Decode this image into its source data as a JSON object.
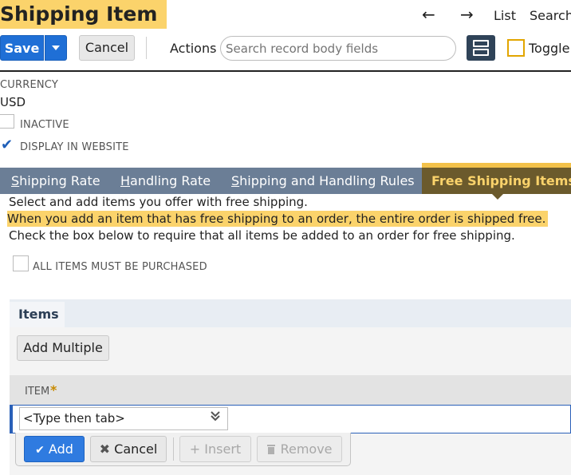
{
  "header": {
    "title": "Shipping Item",
    "nav_back_icon": "←",
    "nav_forward_icon": "→",
    "list_link": "List",
    "search_link": "Search"
  },
  "toolbar": {
    "save_label": "Save",
    "cancel_label": "Cancel",
    "actions_label": "Actions",
    "search_placeholder": "Search record body fields",
    "toggle_label": "Toggle"
  },
  "fields": {
    "currency_label": "CURRENCY",
    "currency_value": "USD",
    "inactive_label": "INACTIVE",
    "inactive_checked": false,
    "display_label": "DISPLAY IN WEBSITE",
    "display_checked": true,
    "check_glyph": "✔"
  },
  "tabs": [
    {
      "label": "Shipping Rate",
      "active": false
    },
    {
      "label": "Handling Rate",
      "active": false
    },
    {
      "label": "Shipping and Handling Rules",
      "active": false
    },
    {
      "label": "Free Shipping Items",
      "active": true
    }
  ],
  "free_shipping": {
    "line1": "Select and add items you offer with free shipping.",
    "line2": "When you add an item that has free shipping to an order, the entire order is shipped free.",
    "line3": "Check the box below to require that all items be added to an order for free shipping.",
    "all_items_label": "ALL ITEMS MUST BE PURCHASED",
    "all_items_checked": false
  },
  "items": {
    "subtab_label": "Items",
    "add_multiple_label": "Add Multiple",
    "column_item": "ITEM",
    "required_mark": "*",
    "item_placeholder": "<Type then tab>",
    "add_label": "Add",
    "cancel_label": "Cancel",
    "insert_label": "Insert",
    "remove_label": "Remove"
  },
  "colors": {
    "accent": "#fbd36b",
    "primary": "#1f6fd6",
    "tabbar": "#6b7e96",
    "active_tab": "#6b5a2c"
  }
}
